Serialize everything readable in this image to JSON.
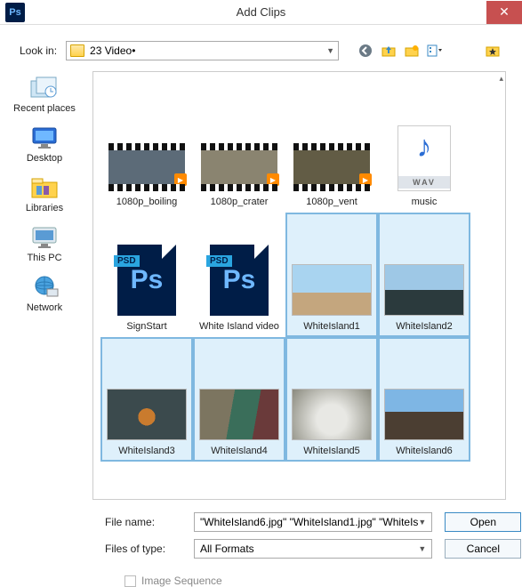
{
  "title": "Add Clips",
  "app_icon_text": "Ps",
  "lookin_label": "Look in:",
  "lookin_value": "23 Video•",
  "sidebar": [
    {
      "label": "Recent places"
    },
    {
      "label": "Desktop"
    },
    {
      "label": "Libraries"
    },
    {
      "label": "This PC"
    },
    {
      "label": "Network"
    }
  ],
  "files": [
    {
      "label": "1080p_boiling",
      "kind": "video",
      "selected": false
    },
    {
      "label": "1080p_crater",
      "kind": "video",
      "selected": false
    },
    {
      "label": "1080p_vent",
      "kind": "video",
      "selected": false
    },
    {
      "label": "music",
      "kind": "wav",
      "selected": false
    },
    {
      "label": "SignStart",
      "kind": "psd",
      "selected": false
    },
    {
      "label": "White Island video",
      "kind": "psd",
      "selected": false
    },
    {
      "label": "WhiteIsland1",
      "kind": "image",
      "selected": true
    },
    {
      "label": "WhiteIsland2",
      "kind": "image",
      "selected": true
    },
    {
      "label": "WhiteIsland3",
      "kind": "image",
      "selected": true
    },
    {
      "label": "WhiteIsland4",
      "kind": "image",
      "selected": true
    },
    {
      "label": "WhiteIsland5",
      "kind": "image",
      "selected": true
    },
    {
      "label": "WhiteIsland6",
      "kind": "image",
      "selected": true
    }
  ],
  "wav_tag": "WAV",
  "psd_badge": "PSD",
  "ps_text": "Ps",
  "filename_label": "File name:",
  "filename_value": "\"WhiteIsland6.jpg\" \"WhiteIsland1.jpg\" \"WhiteIs",
  "filetype_label": "Files of type:",
  "filetype_value": "All Formats",
  "open_label": "Open",
  "cancel_label": "Cancel",
  "image_sequence_label": "Image Sequence"
}
